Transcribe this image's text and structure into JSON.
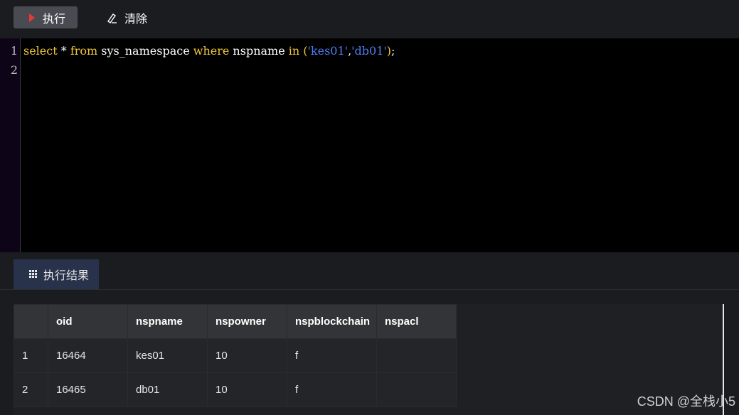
{
  "toolbar": {
    "run_label": "执行",
    "clear_label": "清除"
  },
  "editor": {
    "line_numbers": [
      "1",
      "2"
    ],
    "code": {
      "kw_select": "select",
      "star": " * ",
      "kw_from": "from",
      "table": " sys_namespace ",
      "kw_where": "where",
      "column": " nspname ",
      "kw_in": "in",
      "space": " ",
      "open_paren": "(",
      "str1": "'kes01'",
      "comma": ",",
      "str2": "'db01'",
      "close_paren": ")",
      "semicolon": ";"
    }
  },
  "results": {
    "tab_label": "执行结果",
    "columns": [
      "",
      "oid",
      "nspname",
      "nspowner",
      "nspblockchain",
      "nspacl"
    ],
    "rows": [
      [
        "1",
        "16464",
        "kes01",
        "10",
        "f",
        ""
      ],
      [
        "2",
        "16465",
        "db01",
        "10",
        "f",
        ""
      ]
    ]
  },
  "watermark": "CSDN @全栈小5",
  "colors": {
    "keyword": "#f0c63a",
    "string": "#4d7ef2",
    "run_icon": "#e53935",
    "tab_active": "#28324a"
  }
}
